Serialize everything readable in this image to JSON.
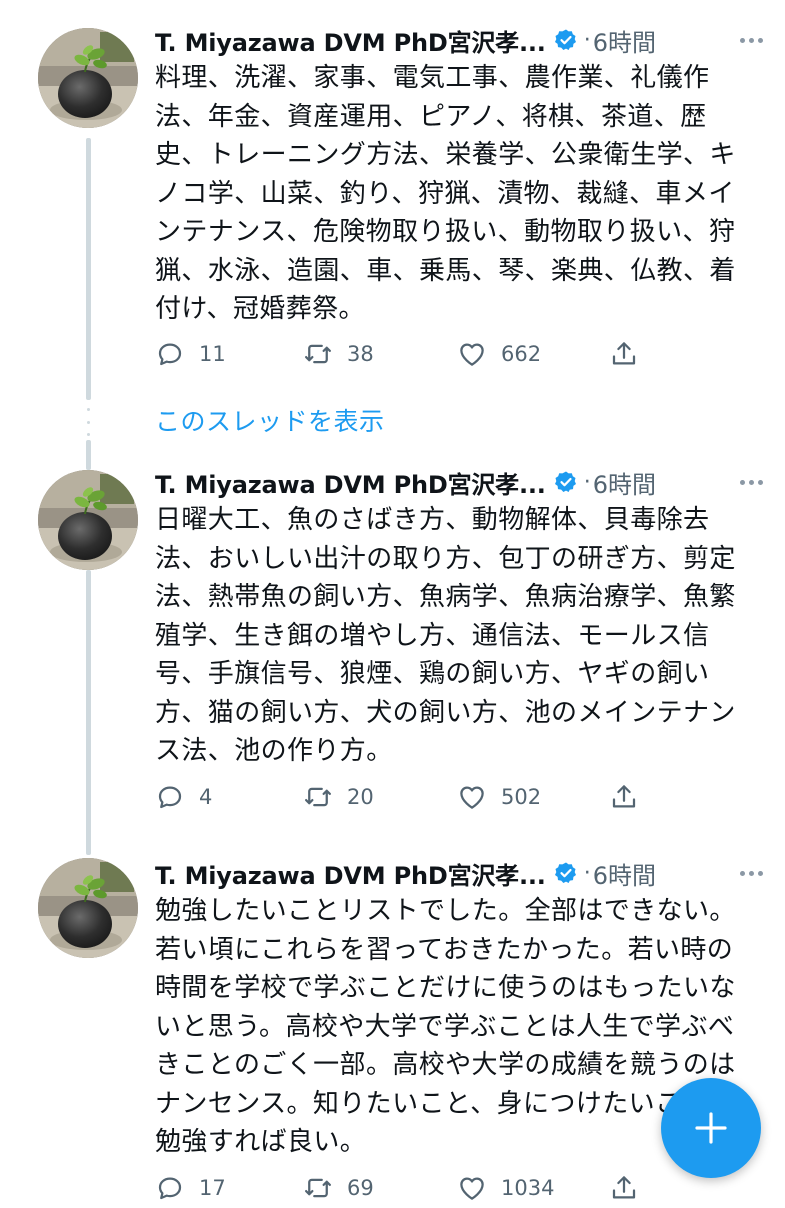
{
  "thread": {
    "show_thread_label": "このスレッドを表示"
  },
  "tweets": [
    {
      "author": "T. Miyazawa DVM PhD宮沢孝...",
      "separator": "·",
      "time": "6時間",
      "text": "料理、洗濯、家事、電気工事、農作業、礼儀作法、年金、資産運用、ピアノ、将棋、茶道、歴史、トレーニング方法、栄養学、公衆衛生学、キノコ学、山菜、釣り、狩猟、漬物、裁縫、車メインテナンス、危険物取り扱い、動物取り扱い、狩猟、水泳、造園、車、乗馬、琴、楽典、仏教、着付け、冠婚葬祭。",
      "replies": "11",
      "retweets": "38",
      "likes": "662"
    },
    {
      "author": "T. Miyazawa DVM PhD宮沢孝...",
      "separator": "·",
      "time": "6時間",
      "text": "日曜大工、魚のさばき方、動物解体、貝毒除去法、おいしい出汁の取り方、包丁の研ぎ方、剪定法、熱帯魚の飼い方、魚病学、魚病治療学、魚繁殖学、生き餌の増やし方、通信法、モールス信号、手旗信号、狼煙、鶏の飼い方、ヤギの飼い方、猫の飼い方、犬の飼い方、池のメインテナンス法、池の作り方。",
      "replies": "4",
      "retweets": "20",
      "likes": "502"
    },
    {
      "author": "T. Miyazawa DVM PhD宮沢孝...",
      "separator": "·",
      "time": "6時間",
      "text": "勉強したいことリストでした。全部はできない。若い頃にこれらを習っておきたかった。若い時の時間を学校で学ぶことだけに使うのはもったいないと思う。高校や大学で学ぶことは人生で学ぶべきことのごく一部。高校や大学の成績を競うのはナンセンス。知りたいこと、身につけたいことを勉強すれば良い。",
      "replies": "17",
      "retweets": "69",
      "likes": "1034"
    }
  ],
  "icons": {
    "reply": "reply-icon",
    "retweet": "retweet-icon",
    "like": "heart-icon",
    "share": "share-icon",
    "verified": "verified-badge-icon",
    "more": "more-options-icon",
    "compose": "compose-plus-icon"
  },
  "colors": {
    "accent": "#1d9bf0",
    "secondary_text": "#536471",
    "thread_line": "#cfd9de"
  }
}
